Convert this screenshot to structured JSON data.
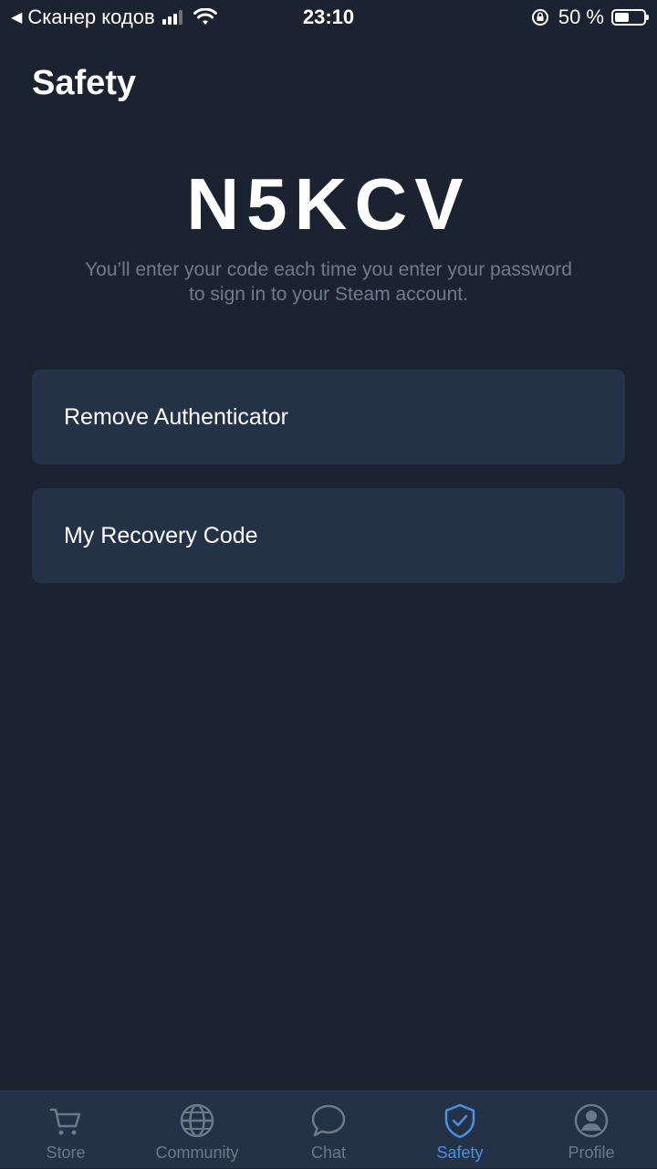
{
  "status_bar": {
    "back_app": "Сканер кодов",
    "time": "23:10",
    "battery": "50 %",
    "battery_level": 0.5
  },
  "header": {
    "title": "Safety"
  },
  "authenticator": {
    "code": "N5KCV",
    "description": "You’ll enter your code each time you enter your password to sign in to your Steam account."
  },
  "actions": [
    {
      "label": "Remove Authenticator"
    },
    {
      "label": "My Recovery Code"
    }
  ],
  "tab_bar": {
    "tabs": [
      {
        "label": "Store",
        "icon": "cart-icon"
      },
      {
        "label": "Community",
        "icon": "globe-icon"
      },
      {
        "label": "Chat",
        "icon": "chat-bubble-icon"
      },
      {
        "label": "Safety",
        "icon": "shield-check-icon",
        "active": true
      },
      {
        "label": "Profile",
        "icon": "user-circle-icon"
      }
    ],
    "active_color": "#4b8fe0",
    "inactive_color": "#6d7889"
  },
  "colors": {
    "background": "#1c2330",
    "card": "#243247",
    "muted_text": "#6f7b8c"
  }
}
